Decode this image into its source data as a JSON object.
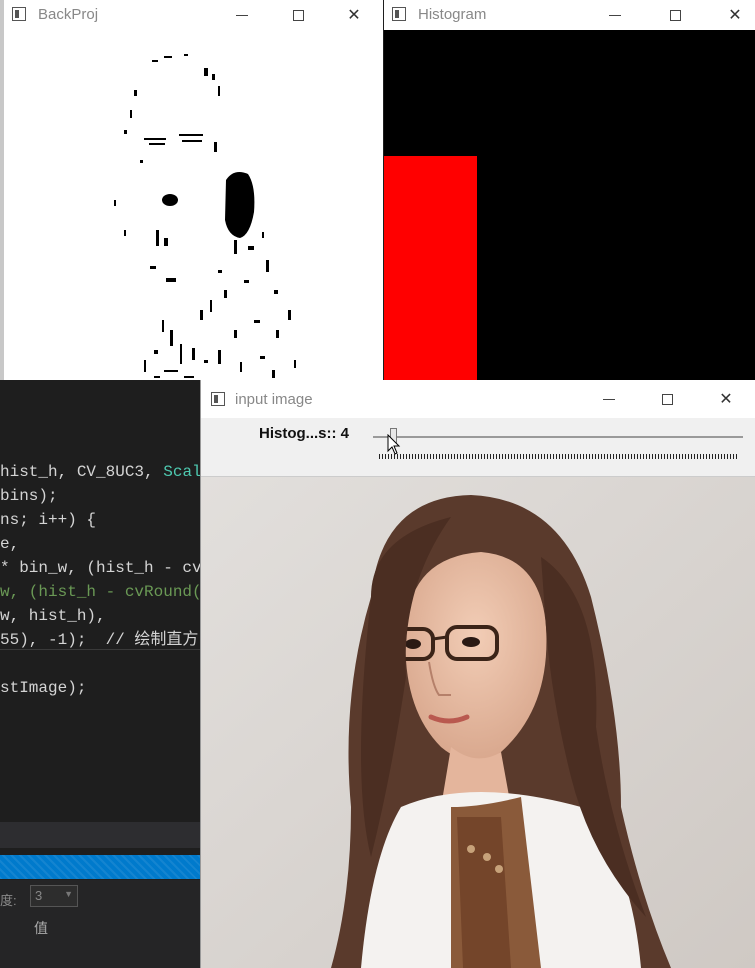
{
  "editor": {
    "code_lines": [
      {
        "parts": [
          {
            "t": "hist_h, CV_8UC3, ",
            "c": ""
          },
          {
            "t": "Scal",
            "c": "kw-teal"
          }
        ]
      },
      {
        "parts": [
          {
            "t": "bins);",
            "c": ""
          }
        ]
      },
      {
        "parts": [
          {
            "t": "ns; i++) {",
            "c": ""
          }
        ]
      },
      {
        "parts": [
          {
            "t": "e,",
            "c": ""
          }
        ]
      },
      {
        "parts": [
          {
            "t": "* bin_w, (hist_h - cv",
            "c": ""
          }
        ]
      },
      {
        "parts": [
          {
            "t": "w, (hist_h - cvRound(",
            "c": "kw-green"
          }
        ]
      },
      {
        "parts": [
          {
            "t": "w, hist_h),",
            "c": ""
          }
        ]
      },
      {
        "parts": [
          {
            "t": "55), -1);  // 绘制直方",
            "c": ""
          }
        ]
      },
      {
        "parts": [
          {
            "t": "",
            "c": ""
          }
        ]
      },
      {
        "parts": [
          {
            "t": "stImage);",
            "c": ""
          }
        ]
      }
    ],
    "depth_label": "度:",
    "depth_value": "3",
    "value_label": "值"
  },
  "windows": {
    "backproj": {
      "title": "BackProj"
    },
    "histogram": {
      "title": "Histogram"
    },
    "input": {
      "title": "input image"
    }
  },
  "trackbar": {
    "label": "Histog...s:: 4",
    "value": 4
  },
  "histogram_data": {
    "bins": [
      {
        "bin": 1,
        "height_fraction": 0.64
      }
    ]
  },
  "colors": {
    "histogram_bar": "#ff0000",
    "histogram_bg": "#000000"
  },
  "icons": {
    "minimize": "minimize-icon",
    "maximize": "maximize-icon",
    "close": "close-icon"
  }
}
